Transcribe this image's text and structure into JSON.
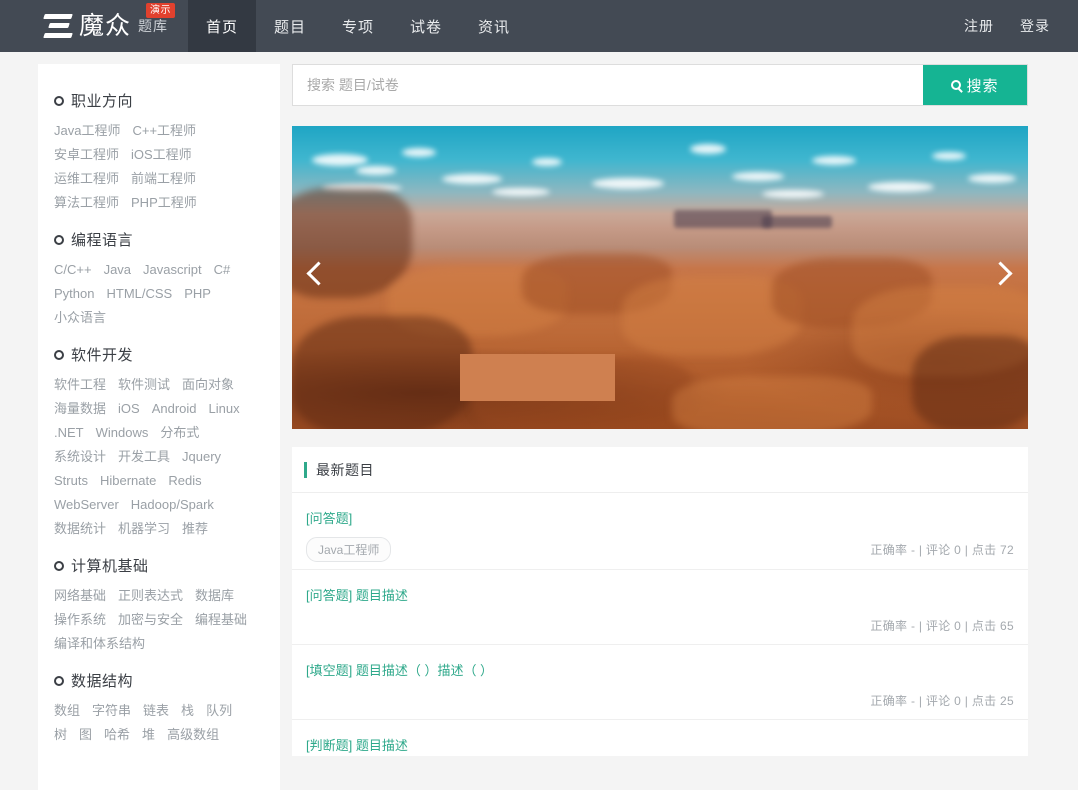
{
  "header": {
    "logo_text": "魔众",
    "logo_sub": "题库",
    "demo_badge": "演示",
    "nav": [
      {
        "label": "首页",
        "active": true
      },
      {
        "label": "题目",
        "active": false
      },
      {
        "label": "专项",
        "active": false
      },
      {
        "label": "试卷",
        "active": false
      },
      {
        "label": "资讯",
        "active": false
      }
    ],
    "auth": [
      {
        "label": "注册"
      },
      {
        "label": "登录"
      }
    ],
    "bg_color": "#434a54",
    "active_bg_color": "#333942"
  },
  "search": {
    "placeholder": "搜索 题目/试卷",
    "value": "",
    "button_label": "搜索",
    "button_color": "#15b493"
  },
  "sidebar": {
    "sections": [
      {
        "title": "职业方向",
        "items": [
          "Java工程师",
          "C++工程师",
          "安卓工程师",
          "iOS工程师",
          "运维工程师",
          "前端工程师",
          "算法工程师",
          "PHP工程师"
        ]
      },
      {
        "title": "编程语言",
        "items": [
          "C/C++",
          "Java",
          "Javascript",
          "C#",
          "Python",
          "HTML/CSS",
          "PHP",
          "小众语言"
        ]
      },
      {
        "title": "软件开发",
        "items": [
          "软件工程",
          "软件测试",
          "面向对象",
          "海量数据",
          "iOS",
          "Android",
          "Linux",
          ".NET",
          "Windows",
          "分布式",
          "系统设计",
          "开发工具",
          "Jquery",
          "Struts",
          "Hibernate",
          "Redis",
          "WebServer",
          "Hadoop/Spark",
          "数据统计",
          "机器学习",
          "推荐"
        ]
      },
      {
        "title": "计算机基础",
        "items": [
          "网络基础",
          "正则表达式",
          "数据库",
          "操作系统",
          "加密与安全",
          "编程基础",
          "编译和体系结构"
        ]
      },
      {
        "title": "数据结构",
        "items": [
          "数组",
          "字符串",
          "链表",
          "栈",
          "队列",
          "树",
          "图",
          "哈希",
          "堆",
          "高级数组"
        ]
      }
    ]
  },
  "carousel": {
    "prev_label": "上一张",
    "next_label": "下一张",
    "slide_alt": "沙漠峡谷风景"
  },
  "latest": {
    "title": "最新题目",
    "accent_color": "#2fa98b",
    "items": [
      {
        "link": "[问答题]",
        "tag": "Java工程师",
        "meta": "正确率 - | 评论 0 | 点击 72"
      },
      {
        "link": "[问答题] 题目描述",
        "tag": "",
        "meta": "正确率 - | 评论 0 | 点击 65"
      },
      {
        "link": "[填空题] 题目描述（ ）描述（ ）",
        "tag": "",
        "meta": "正确率 - | 评论 0 | 点击 25"
      },
      {
        "link": "[判断题] 题目描述",
        "tag": "",
        "meta": ""
      }
    ]
  }
}
